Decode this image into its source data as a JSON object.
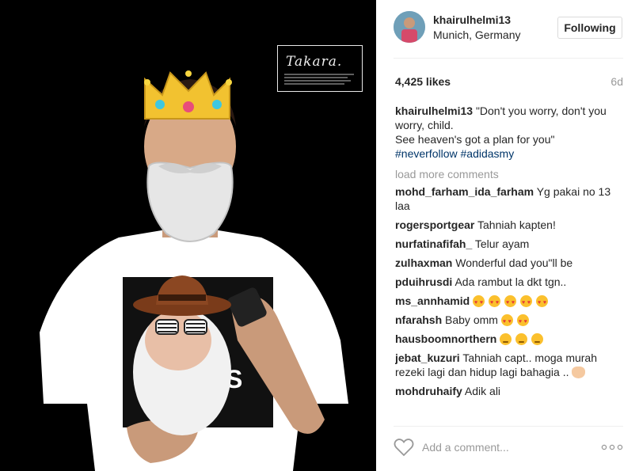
{
  "post": {
    "username": "khairulhelmi13",
    "location": "Munich, Germany",
    "follow_label": "Following",
    "likes": "4,425 likes",
    "age": "6d",
    "watermark": "Takara.",
    "caption": {
      "user": "khairulhelmi13",
      "line1": "\"Don't you worry, don't you worry, child.",
      "line2": "See heaven's got a plan for you\"",
      "hashtags": [
        "#neverfollow",
        "#adidasmy"
      ]
    },
    "load_more": "load more comments"
  },
  "comments": [
    {
      "user": "mohd_farham_ida_farham",
      "text": "Yg pakai no 13 laa"
    },
    {
      "user": "rogersportgear",
      "text": "Tahniah kapten!"
    },
    {
      "user": "nurfatinafifah_",
      "text": "Telur ayam"
    },
    {
      "user": "zulhaxman",
      "text": "Wonderful dad you\"ll be"
    },
    {
      "user": "pduihrusdi",
      "text": "Ada rambut la dkt tgn.."
    },
    {
      "user": "ms_annhamid",
      "text": "",
      "emojis": [
        "heart-eyes",
        "heart-eyes",
        "heart-eyes",
        "heart-eyes",
        "heart-eyes"
      ]
    },
    {
      "user": "nfarahsh",
      "text": "Baby omm",
      "emojis": [
        "heart-eyes",
        "heart-eyes"
      ]
    },
    {
      "user": "hausboomnorthern",
      "text": "",
      "emojis": [
        "blush",
        "blush",
        "blush"
      ]
    },
    {
      "user": "jebat_kuzuri",
      "text": "Tahniah capt.. moga murah rezeki lagi dan hidup lagi bahagia ..",
      "emojis": [
        "muscle"
      ]
    },
    {
      "user": "mohdruhaify",
      "text": "Adik ali"
    }
  ],
  "footer": {
    "comment_placeholder": "Add a comment...",
    "like_icon": "heart-outline-icon",
    "more_icon": "more-options-icon"
  },
  "colors": {
    "hashtag": "#003569",
    "muted": "#999999",
    "border": "#efefef"
  }
}
